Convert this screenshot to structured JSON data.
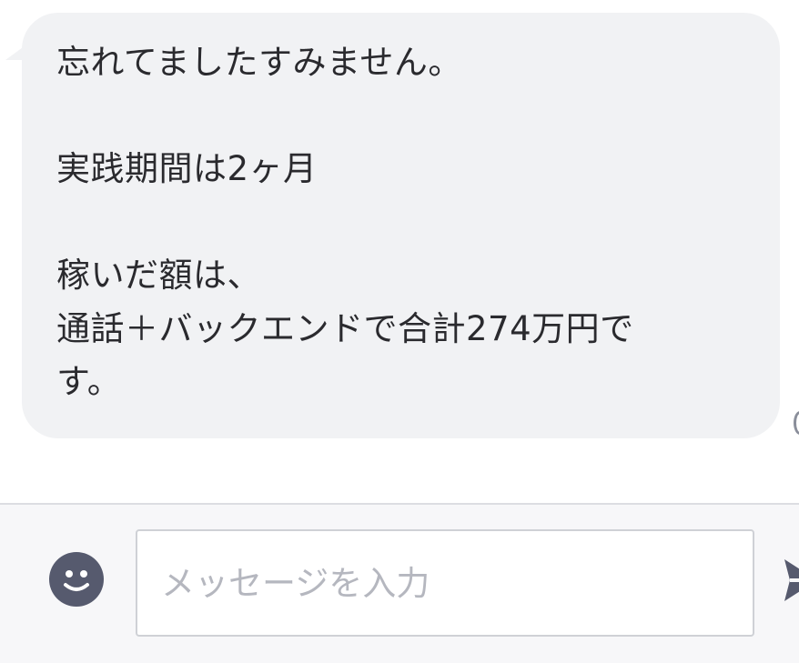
{
  "chat": {
    "messages": [
      {
        "text": "忘れてましたすみません。\n\n実践期間は2ヶ月\n\n稼いだ額は、\n通話＋バックエンドで合計274万円で\nす。"
      }
    ]
  },
  "composer": {
    "input_placeholder": "メッセージを入力",
    "emoji_icon": "smiley-face-icon",
    "send_icon": "paper-plane-icon"
  },
  "colors": {
    "bubble": "#f1f2f4",
    "text": "#2a2a2e",
    "composer_bg": "#f7f7f9",
    "icon": "#565a6e",
    "placeholder": "#b5b7bf"
  }
}
